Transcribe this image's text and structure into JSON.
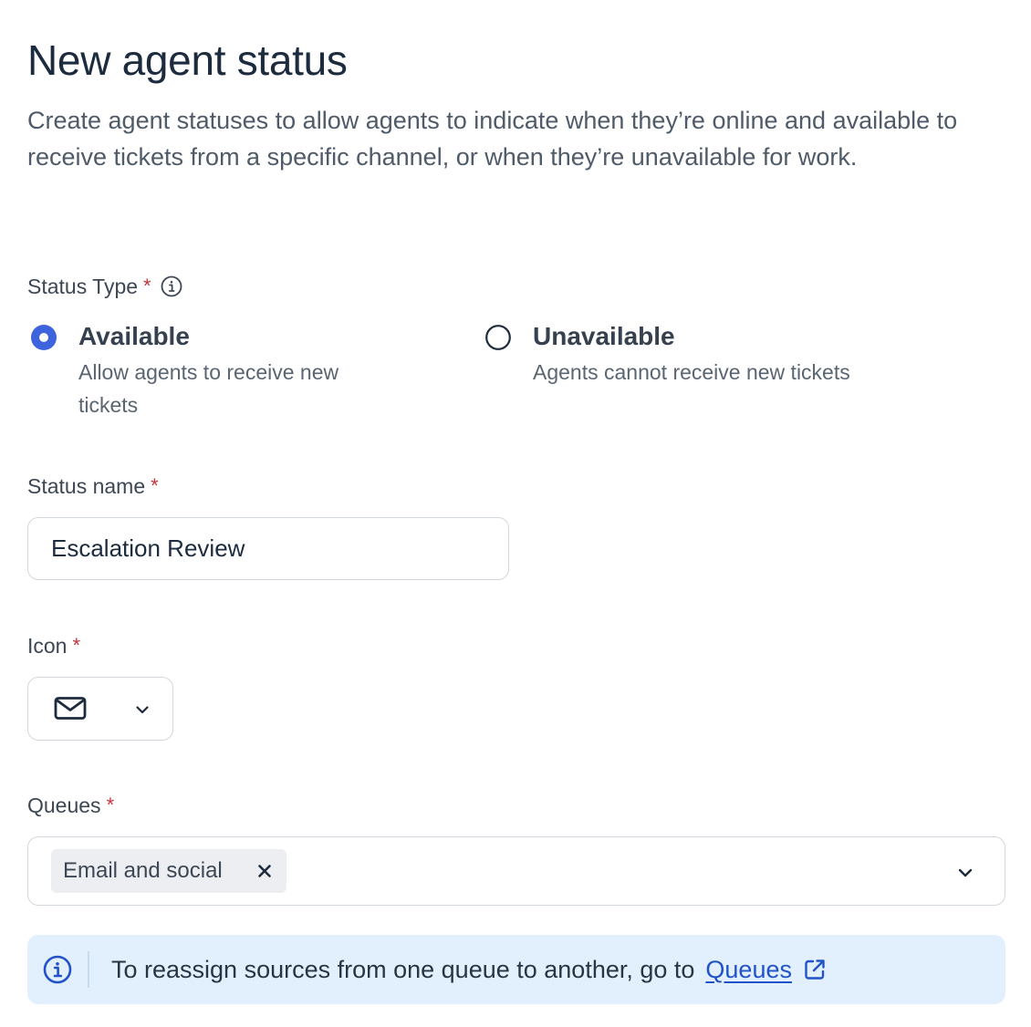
{
  "header": {
    "title": "New agent status",
    "description": "Create agent statuses to allow agents to indicate when they’re online and available to receive tickets from a specific channel, or when they’re unavailable for work."
  },
  "status_type": {
    "label": "Status Type",
    "required_mark": "*",
    "info_icon": "info-circle-icon",
    "options": [
      {
        "title": "Available",
        "subtitle": "Allow agents to receive new tickets",
        "selected": true
      },
      {
        "title": "Unavailable",
        "subtitle": "Agents cannot receive new tickets",
        "selected": false
      }
    ]
  },
  "status_name": {
    "label": "Status name",
    "required_mark": "*",
    "value": "Escalation Review"
  },
  "icon_field": {
    "label": "Icon",
    "required_mark": "*",
    "selected_icon": "mail-icon",
    "dropdown_icon": "chevron-down-icon"
  },
  "queues": {
    "label": "Queues",
    "required_mark": "*",
    "selected": [
      "Email and social"
    ],
    "remove_icon": "close-icon",
    "dropdown_icon": "chevron-down-icon"
  },
  "info_banner": {
    "icon": "info-circle-icon",
    "text": "To reassign sources from one queue to another, go to",
    "link_label": "Queues",
    "link_icon": "external-link-icon"
  },
  "colors": {
    "accent": "#3d63dd",
    "required": "#c6323a",
    "link": "#2152c9",
    "banner_bg": "#e2f0fd",
    "chip_bg": "#eceef1",
    "border": "#d3d8de"
  }
}
